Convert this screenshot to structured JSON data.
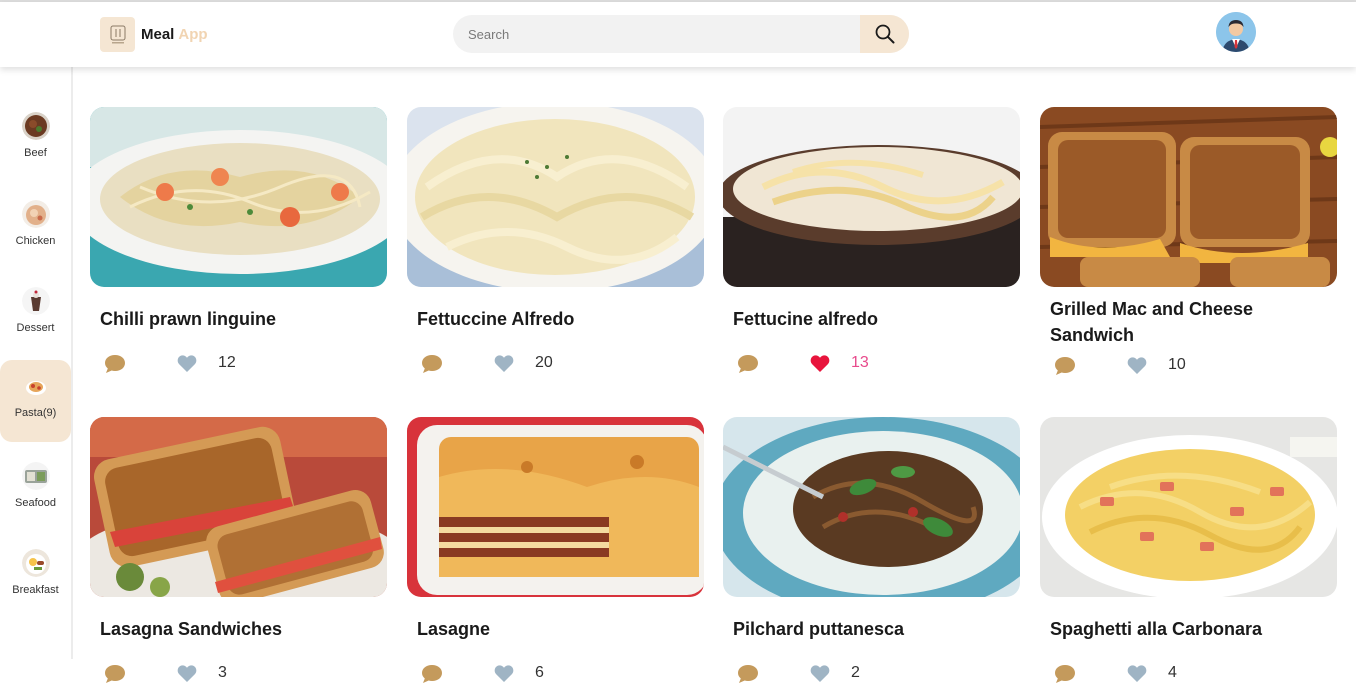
{
  "header": {
    "logo_primary": "Meal",
    "logo_secondary": "App",
    "search_placeholder": "Search"
  },
  "sidebar": {
    "categories": [
      {
        "label": "Beef",
        "active": false
      },
      {
        "label": "Chicken",
        "active": false
      },
      {
        "label": "Dessert",
        "active": false
      },
      {
        "label": "Pasta(9)",
        "active": true
      },
      {
        "label": "Seafood",
        "active": false
      },
      {
        "label": "Breakfast",
        "active": false
      }
    ]
  },
  "meals": [
    {
      "title": "Chilli prawn linguine",
      "likes": "12",
      "liked": false
    },
    {
      "title": "Fettuccine Alfredo",
      "likes": "20",
      "liked": false
    },
    {
      "title": "Fettucine alfredo",
      "likes": "13",
      "liked": true
    },
    {
      "title": "Grilled Mac and Cheese Sandwich",
      "likes": "10",
      "liked": false
    },
    {
      "title": "Lasagna Sandwiches",
      "likes": "3",
      "liked": false
    },
    {
      "title": "Lasagne",
      "likes": "6",
      "liked": false
    },
    {
      "title": "Pilchard puttanesca",
      "likes": "2",
      "liked": false
    },
    {
      "title": "Spaghetti alla Carbonara",
      "likes": "4",
      "liked": false
    }
  ],
  "colors": {
    "accent": "#f5e6d3",
    "comment_icon": "#c49a5c",
    "heart_default": "#9fb4c4",
    "heart_liked": "#e8143c",
    "liked_count": "#e84a8c"
  },
  "icons": {
    "search": "magnifier-icon",
    "comment": "comment-bubble-icon",
    "like": "heart-icon"
  }
}
